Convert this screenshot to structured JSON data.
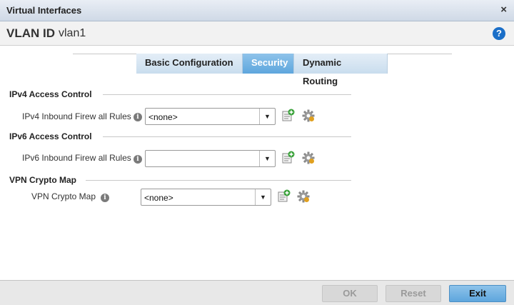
{
  "window": {
    "title": "Virtual Interfaces",
    "close_glyph": "×"
  },
  "header": {
    "id_label": "VLAN ID",
    "id_value": "vlan1",
    "help_glyph": "?"
  },
  "tabs": [
    {
      "label": "Basic Configuration",
      "active": false
    },
    {
      "label": "Security",
      "active": true
    },
    {
      "label": "Dynamic Routing",
      "active": false
    }
  ],
  "sections": {
    "ipv4": {
      "heading": "IPv4 Access Control",
      "field_label": "IPv4 Inbound Firew all Rules",
      "value": "<none>"
    },
    "ipv6": {
      "heading": "IPv6 Access Control",
      "field_label": "IPv6 Inbound Firew all Rules",
      "value": ""
    },
    "vpn": {
      "heading": "VPN Crypto Map",
      "field_label": "VPN Crypto Map",
      "value": "<none>"
    }
  },
  "icons": {
    "info": "info-icon",
    "add": "add-policy-icon",
    "edit": "gear-icon",
    "dropdown": "chevron-down-icon"
  },
  "footer": {
    "ok_label": "OK",
    "reset_label": "Reset",
    "exit_label": "Exit"
  },
  "colors": {
    "accent": "#5ea6dd",
    "help": "#1b6fc8"
  }
}
